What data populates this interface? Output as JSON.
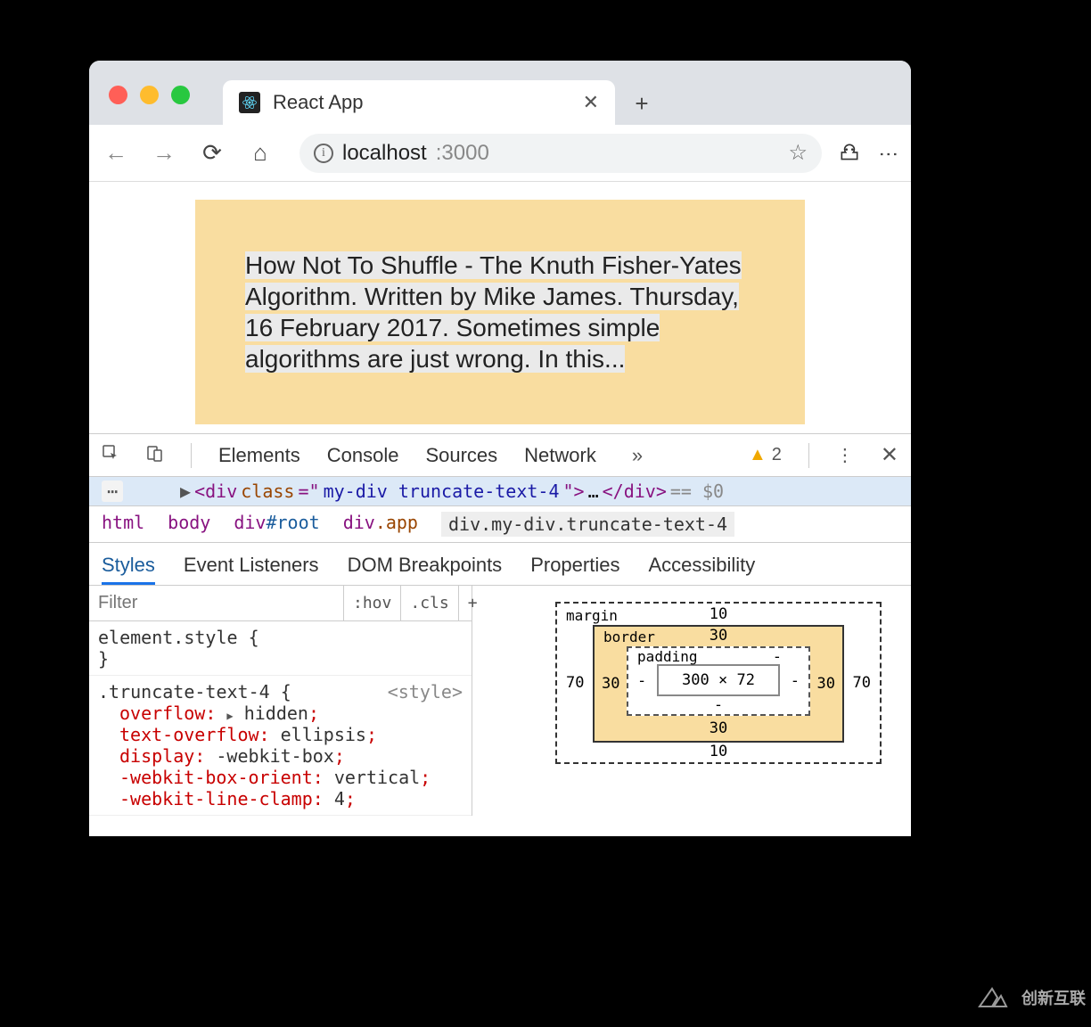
{
  "browser": {
    "tab_title": "React App",
    "url_host": "localhost",
    "url_port": ":3000"
  },
  "page": {
    "truncated_text": "How Not To Shuffle - The Knuth Fisher-Yates Algorithm. Written by Mike James. Thursday, 16 February 2017. Sometimes simple algorithms are just wrong. In this..."
  },
  "devtools": {
    "tabs": [
      "Elements",
      "Console",
      "Sources",
      "Network"
    ],
    "warning_count": "2",
    "dom_line": {
      "open": "<div ",
      "attr_name": "class",
      "eq": "=\"",
      "attr_val": "my-div truncate-text-4",
      "close_attr": "\">",
      "ellipsis": "…",
      "close_tag": "</div>",
      "tail": " == $0"
    },
    "breadcrumb": [
      {
        "tag": "html"
      },
      {
        "tag": "body"
      },
      {
        "tag": "div",
        "id": "#root"
      },
      {
        "tag": "div",
        "cls": ".app"
      },
      {
        "sel": "div.my-div.truncate-text-4"
      }
    ],
    "subtabs": [
      "Styles",
      "Event Listeners",
      "DOM Breakpoints",
      "Properties",
      "Accessibility"
    ],
    "filter_placeholder": "Filter",
    "hov": ":hov",
    "cls": ".cls",
    "plus": "+",
    "css": {
      "element_style_open": "element.style {",
      "element_style_close": "}",
      "rule_selector": ".truncate-text-4 {",
      "rule_src": "<style>",
      "props": [
        {
          "n": "overflow",
          "v": "hidden",
          "tri": true
        },
        {
          "n": "text-overflow",
          "v": "ellipsis"
        },
        {
          "n": "display",
          "v": "-webkit-box"
        },
        {
          "n": "-webkit-box-orient",
          "v": "vertical"
        },
        {
          "n": "-webkit-line-clamp",
          "v": "4"
        }
      ]
    },
    "box_model": {
      "margin_label": "margin",
      "border_label": "border",
      "padding_label": "padding",
      "margin": {
        "top": "10",
        "right": "70",
        "bottom": "10",
        "left": "70"
      },
      "border": {
        "top": "30",
        "right": "30",
        "bottom": "30",
        "left": "30"
      },
      "padding": {
        "top": "-",
        "right": "-",
        "bottom": "-",
        "left": "-"
      },
      "content": "300 × 72"
    }
  },
  "watermark": {
    "text": "创新互联"
  }
}
